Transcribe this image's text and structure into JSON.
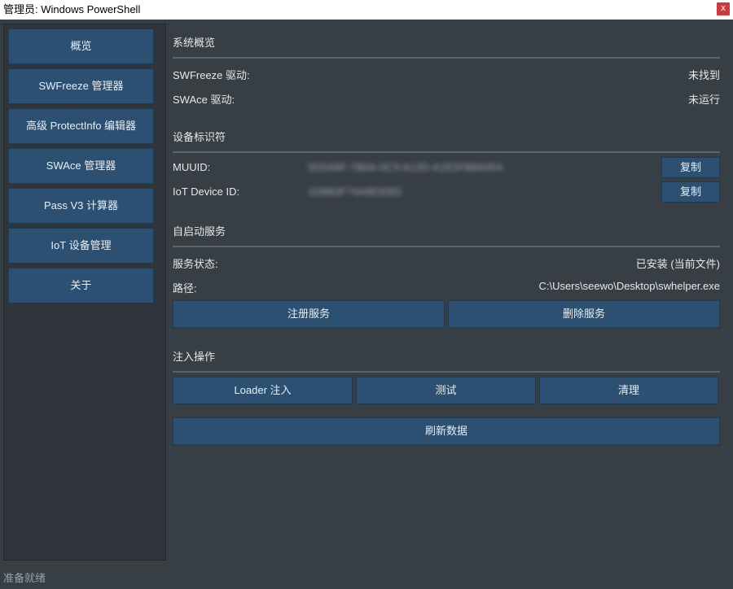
{
  "window": {
    "title": "管理员: Windows PowerShell",
    "close_label": "x"
  },
  "sidebar": {
    "items": [
      {
        "label": "概览"
      },
      {
        "label": "SWFreeze 管理器"
      },
      {
        "label": "高级 ProtectInfo 编辑器"
      },
      {
        "label": "SWAce 管理器"
      },
      {
        "label": "Pass V3 计算器"
      },
      {
        "label": "IoT 设备管理"
      },
      {
        "label": "关于"
      }
    ]
  },
  "overview": {
    "title": "系统概览",
    "rows": [
      {
        "label": "SWFreeze 驱动:",
        "value": "未找到"
      },
      {
        "label": "SWAce 驱动:",
        "value": "未运行"
      }
    ]
  },
  "device": {
    "title": "设备标识符",
    "muuid_label": "MUUID:",
    "muuid_value": "5D5A9F-7B6A-0C3-A13D-A1E5FB8A904",
    "iot_label": "IoT Device ID:",
    "iot_value": "1D8B3F74A9E6082",
    "copy_label": "复制"
  },
  "service": {
    "title": "自启动服务",
    "status_label": "服务状态:",
    "status_value": "已安装 (当前文件)",
    "path_label": "路径:",
    "path_value": "C:\\Users\\seewo\\Desktop\\swhelper.exe",
    "register_label": "注册服务",
    "delete_label": "删除服务"
  },
  "inject": {
    "title": "注入操作",
    "loader_label": "Loader 注入",
    "test_label": "测试",
    "clean_label": "清理",
    "refresh_label": "刷新数据"
  },
  "status": {
    "text": "准备就绪"
  },
  "colors": {
    "background": "#373e44",
    "button": "#2b5071",
    "sidebar": "#2f353a",
    "divider": "#5b6268",
    "close": "#d0393a"
  }
}
